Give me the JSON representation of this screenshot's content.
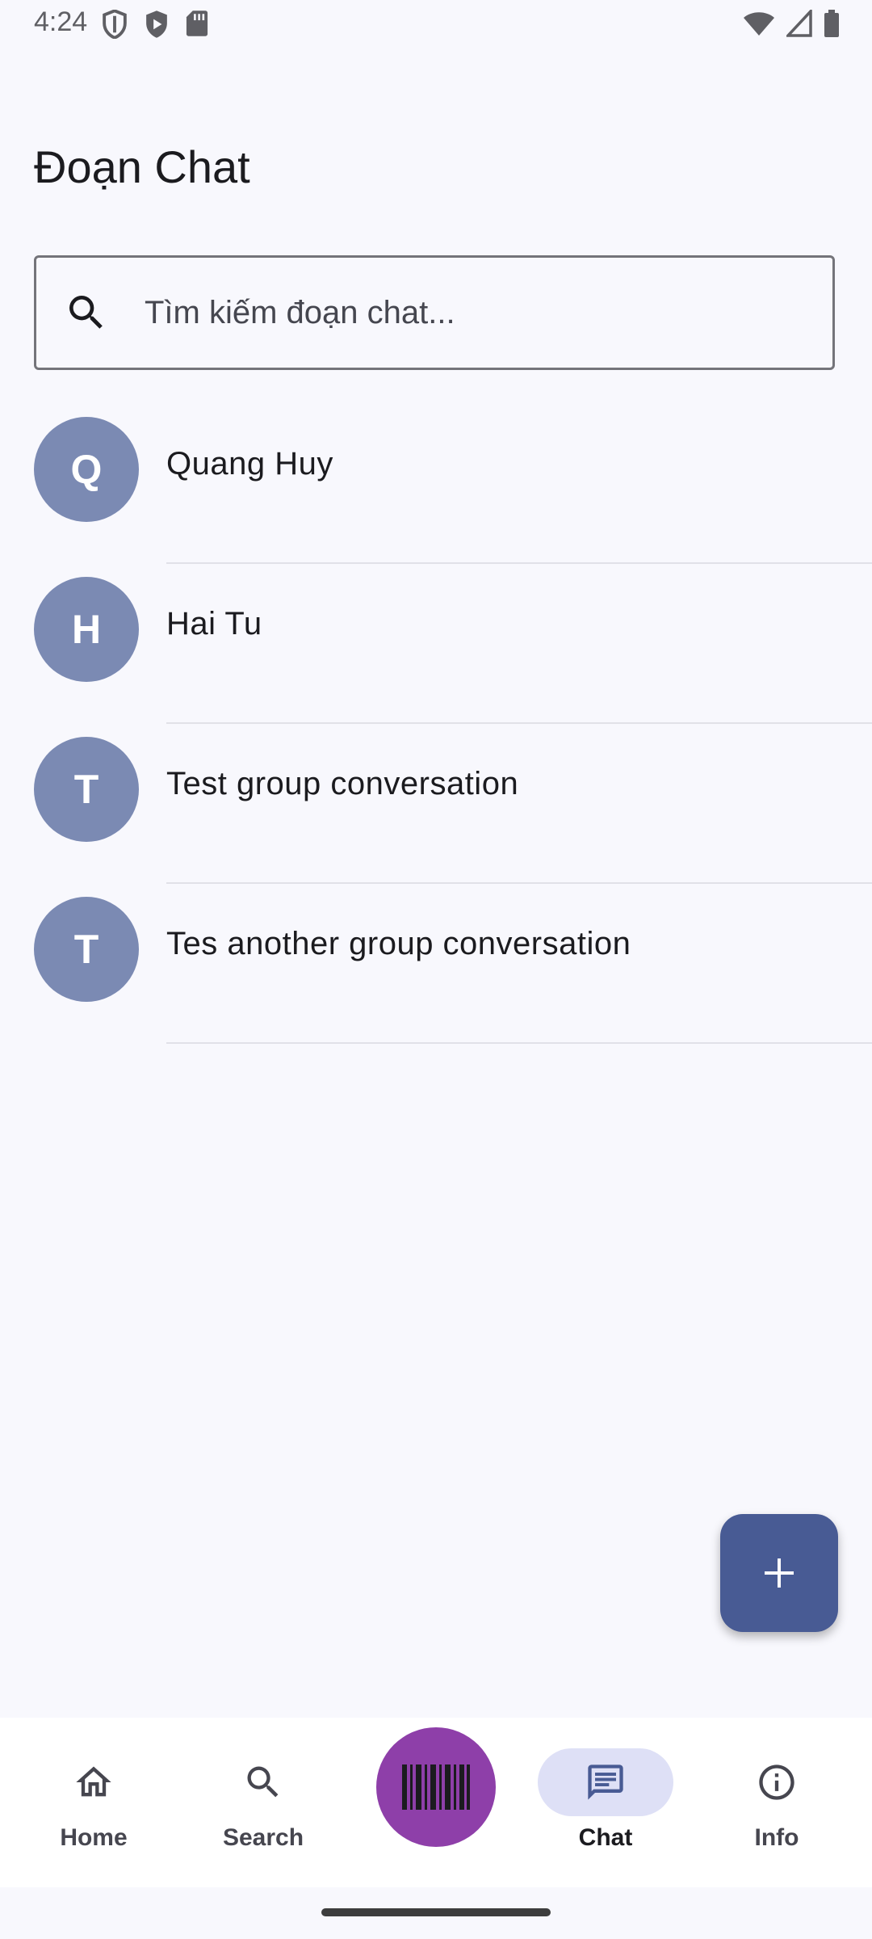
{
  "status_bar": {
    "time": "4:24",
    "left_icons": [
      "shield-icon",
      "play-shield-icon",
      "sd-card-icon"
    ],
    "right_icons": [
      "wifi-icon",
      "signal-icon",
      "battery-icon"
    ]
  },
  "page": {
    "title": "Đoạn Chat"
  },
  "search": {
    "placeholder": "Tìm kiếm đoạn chat...",
    "value": ""
  },
  "chats": [
    {
      "initial": "Q",
      "name": "Quang Huy"
    },
    {
      "initial": "H",
      "name": "Hai Tu"
    },
    {
      "initial": "T",
      "name": "Test group conversation"
    },
    {
      "initial": "T",
      "name": "Tes another group conversation"
    }
  ],
  "fab": {
    "icon": "plus-icon"
  },
  "bottom_nav": {
    "items": [
      {
        "label": "Home",
        "icon": "home-icon",
        "active": false
      },
      {
        "label": "Search",
        "icon": "search-icon",
        "active": false
      },
      {
        "label": "Chat",
        "icon": "chat-icon",
        "active": true
      },
      {
        "label": "Info",
        "icon": "info-icon",
        "active": false
      }
    ],
    "center_button": {
      "icon": "barcode-icon"
    }
  },
  "colors": {
    "background": "#f8f8fd",
    "avatar": "#7b8ab3",
    "fab": "#485b94",
    "scan_button": "#8e3fa9",
    "active_nav_pill": "#dee0f6"
  }
}
